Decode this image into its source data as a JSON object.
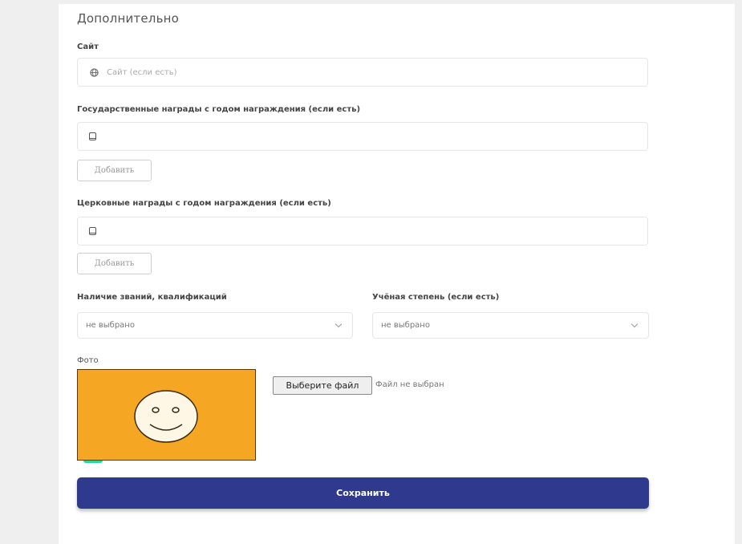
{
  "section": {
    "title": "Дополнительно"
  },
  "site": {
    "label": "Сайт",
    "placeholder": "Сайт (если есть)",
    "icon": "globe-icon"
  },
  "state_awards": {
    "label": "Государственные награды с годом награждения (если есть)",
    "value": "",
    "icon": "book-icon",
    "add_label": "Добавить"
  },
  "church_awards": {
    "label": "Церковные награды с годом награждения (если есть)",
    "value": "",
    "icon": "book-icon",
    "add_label": "Добавить"
  },
  "titles": {
    "label": "Наличие званий, квалификаций",
    "selected": "не выбрано"
  },
  "degree": {
    "label": "Учёная степень (если есть)",
    "selected": "не выбрано"
  },
  "photo": {
    "label": "Фото",
    "choose_button": "Выберите файл",
    "status": "Файл не выбран",
    "placeholder_color": "#f5a623"
  },
  "save": {
    "label": "Сохранить",
    "color": "#2f3a8f"
  }
}
